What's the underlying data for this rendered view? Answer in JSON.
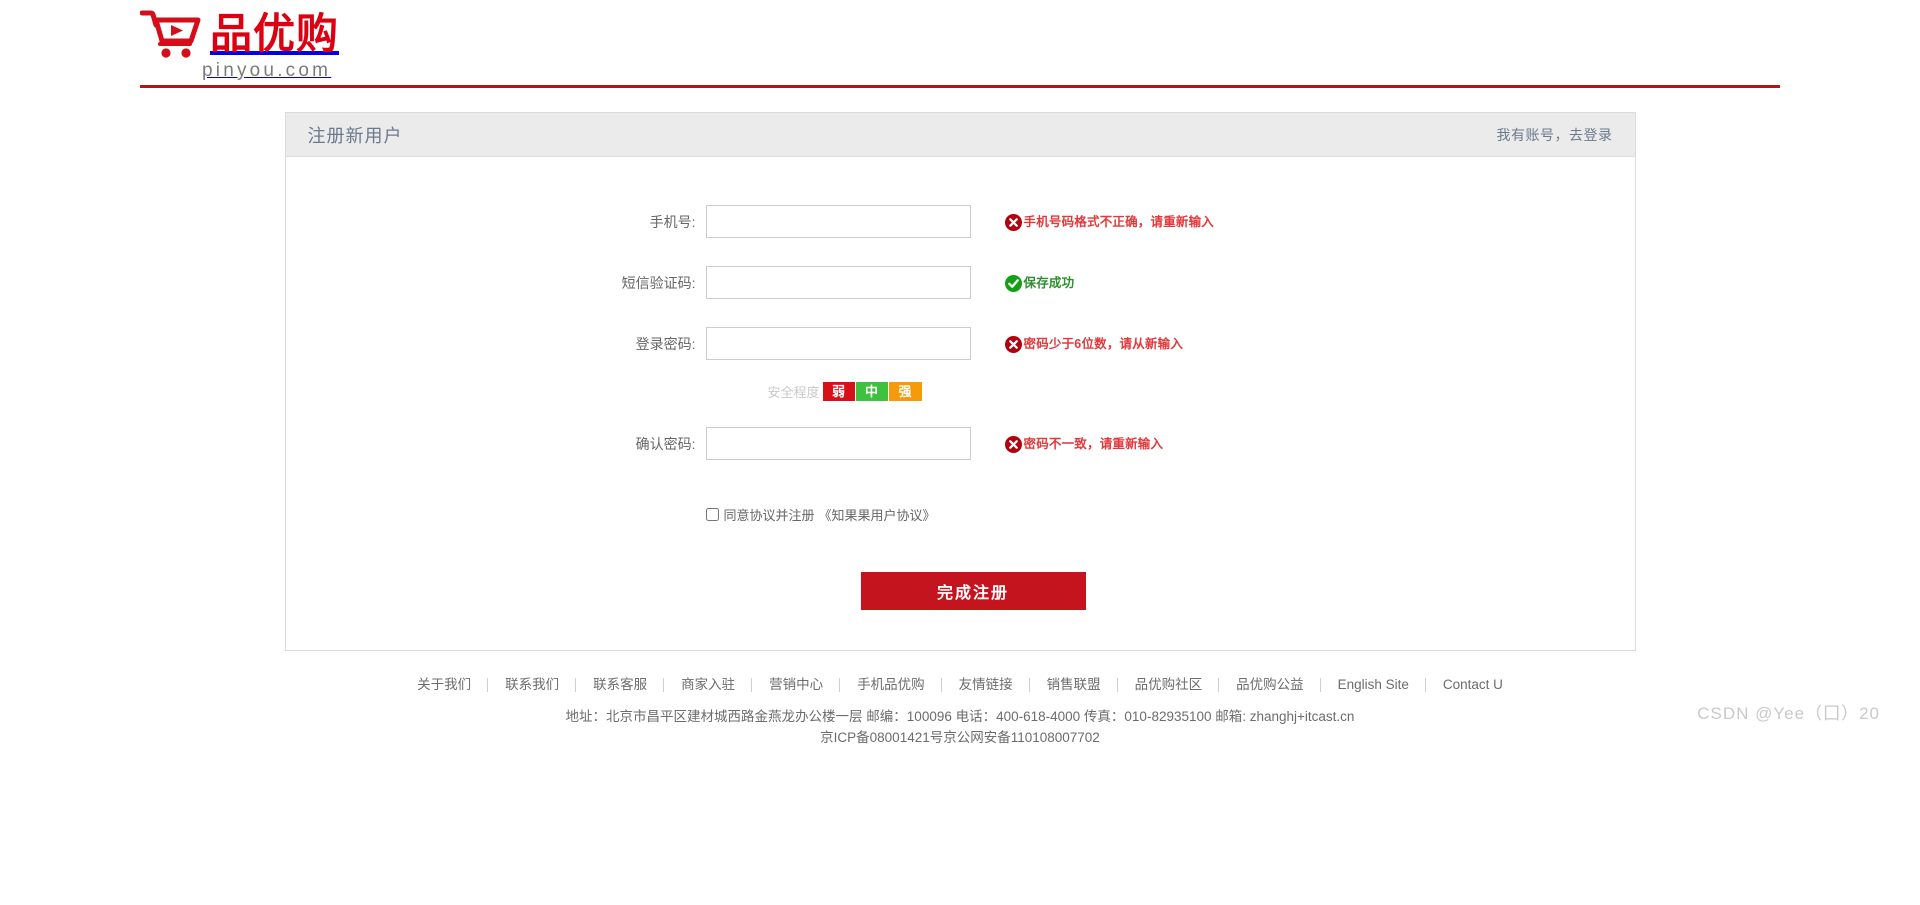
{
  "brand": {
    "name": "品优购",
    "domain": "pinyou.com",
    "logo_icon": "shopping-cart-icon",
    "accent_color": "#c4141e",
    "header_rule_color": "#a81919"
  },
  "register": {
    "title": "注册新用户",
    "login_link": "我有账号，去登录",
    "fields": [
      {
        "id": "phone",
        "label": "手机号:",
        "value": "",
        "placeholder": "",
        "tip_status": "error",
        "tip_icon": "error-circle-icon",
        "tip_text": "手机号码格式不正确，请重新输入"
      },
      {
        "id": "sms-code",
        "label": "短信验证码:",
        "value": "",
        "placeholder": "",
        "tip_status": "success",
        "tip_icon": "success-circle-icon",
        "tip_text": "保存成功"
      },
      {
        "id": "password",
        "label": "登录密码:",
        "value": "",
        "placeholder": "",
        "tip_status": "error",
        "tip_icon": "error-circle-icon",
        "tip_text": "密码少于6位数，请从新输入"
      },
      {
        "id": "confirm-password",
        "label": "确认密码:",
        "value": "",
        "placeholder": "",
        "tip_status": "error",
        "tip_icon": "error-circle-icon",
        "tip_text": "密码不一致，请重新输入"
      }
    ],
    "strength": {
      "label": "安全程度",
      "levels": [
        {
          "label": "弱",
          "color": "#d61118"
        },
        {
          "label": "中",
          "color": "#3ec13e"
        },
        {
          "label": "强",
          "color": "#f59a0b"
        }
      ]
    },
    "agreement": {
      "checked": false,
      "text": "同意协议并注册",
      "link": "《知果果用户协议》"
    },
    "submit_label": "完成注册"
  },
  "footer": {
    "links": [
      "关于我们",
      "联系我们",
      "联系客服",
      "商家入驻",
      "营销中心",
      "手机品优购",
      "友情链接",
      "销售联盟",
      "品优购社区",
      "品优购公益",
      "English Site",
      "Contact U"
    ],
    "address": "地址：北京市昌平区建材城西路金燕龙办公楼一层 邮编：100096 电话：400-618-4000 传真：010-82935100 邮箱: zhanghj+itcast.cn",
    "icp": "京ICP备08001421号京公网安备110108007702"
  },
  "watermark": "CSDN @Yee（囗）20"
}
